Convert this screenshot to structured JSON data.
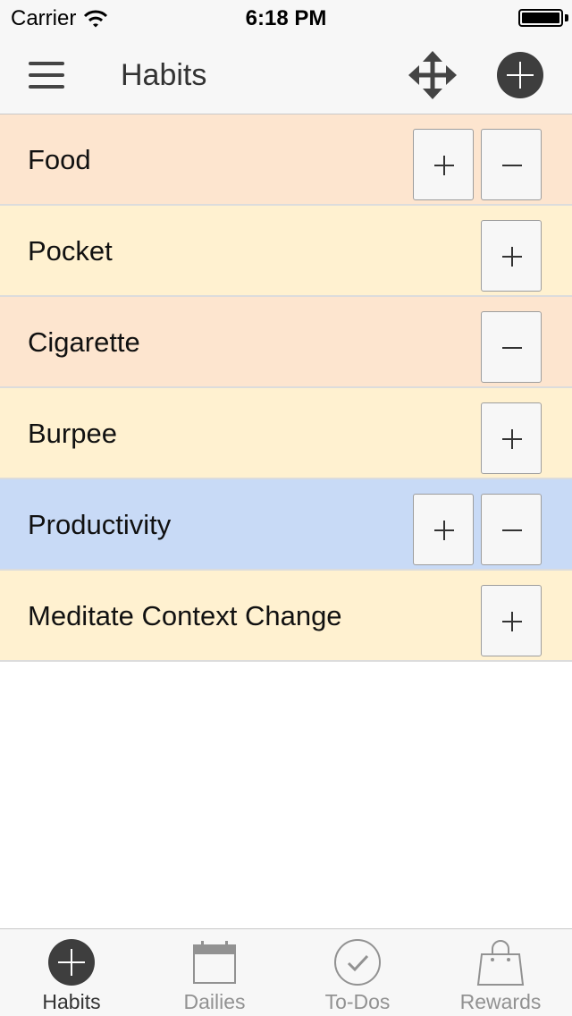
{
  "status_bar": {
    "carrier": "Carrier",
    "time": "6:18 PM"
  },
  "nav": {
    "title": "Habits",
    "menu_icon": "hamburger-icon",
    "move_icon": "move-arrows-icon",
    "add_icon": "add-circle-icon"
  },
  "colors": {
    "orange_row": "#fde5cf",
    "yellow_row": "#fff1d0",
    "blue_row": "#c8daf6",
    "dark_icon": "#3e3e3e"
  },
  "habits": [
    {
      "name": "Food",
      "color": "#fde5cf",
      "up": true,
      "down": true
    },
    {
      "name": "Pocket",
      "color": "#fff1d0",
      "up": true,
      "down": false
    },
    {
      "name": "Cigarette",
      "color": "#fde5cf",
      "up": false,
      "down": true
    },
    {
      "name": "Burpee",
      "color": "#fff1d0",
      "up": true,
      "down": false
    },
    {
      "name": "Productivity",
      "color": "#c8daf6",
      "up": true,
      "down": true
    },
    {
      "name": "Meditate Context Change",
      "color": "#fff1d0",
      "up": true,
      "down": false
    }
  ],
  "tabs": [
    {
      "label": "Habits",
      "icon": "add-circle-icon",
      "active": true
    },
    {
      "label": "Dailies",
      "icon": "calendar-icon",
      "active": false
    },
    {
      "label": "To-Dos",
      "icon": "checkmark-circle-icon",
      "active": false
    },
    {
      "label": "Rewards",
      "icon": "shopping-bag-icon",
      "active": false
    }
  ]
}
